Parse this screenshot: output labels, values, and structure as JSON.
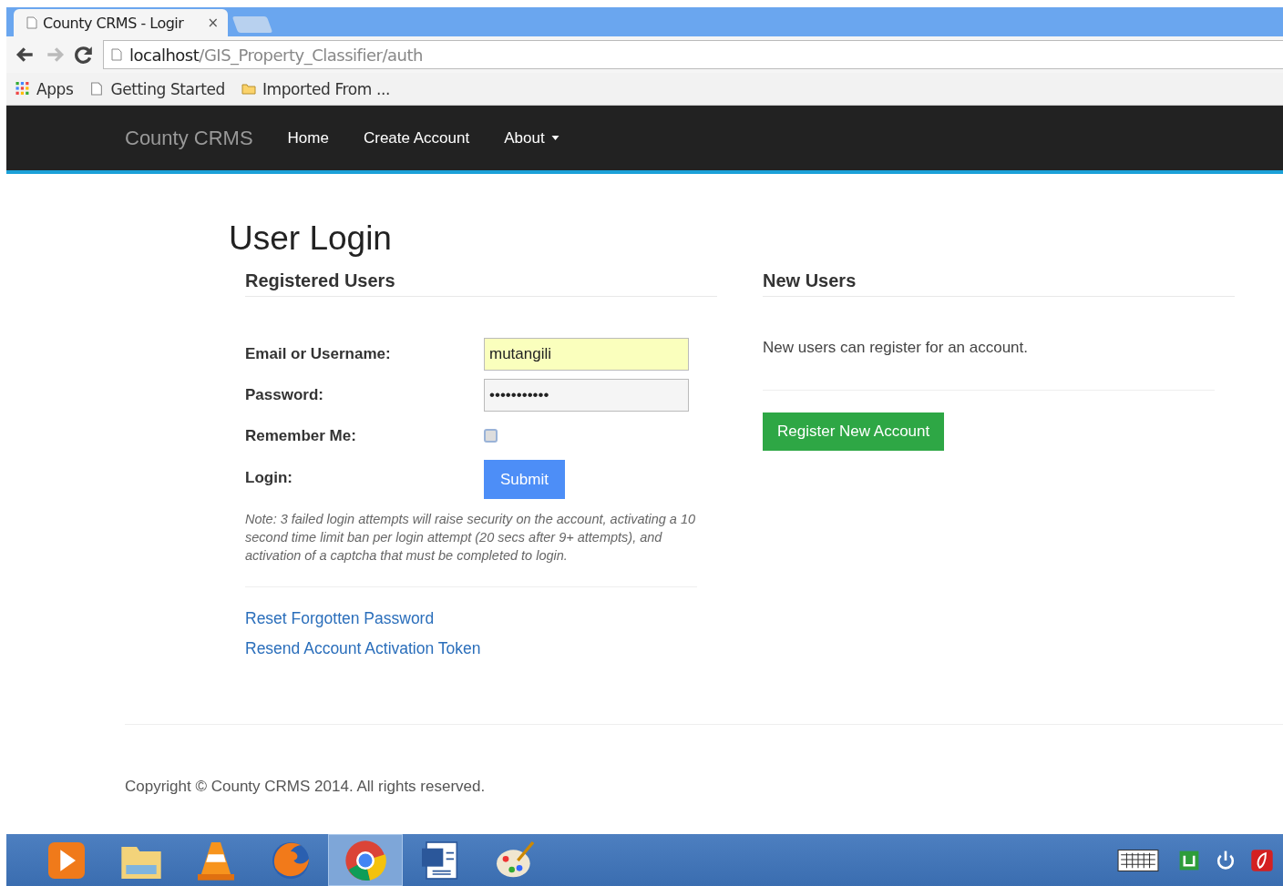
{
  "browser": {
    "tab_title": "County CRMS - Logir",
    "tab_close": "×",
    "address": {
      "host": "localhost",
      "path": "/GIS_Property_Classifier/auth"
    },
    "bookmarks": [
      {
        "kind": "apps",
        "label": "Apps"
      },
      {
        "kind": "page",
        "label": "Getting Started"
      },
      {
        "kind": "folder",
        "label": "Imported From ..."
      }
    ]
  },
  "navbar": {
    "brand": "County CRMS",
    "items": [
      {
        "label": "Home",
        "dropdown": false
      },
      {
        "label": "Create Account",
        "dropdown": false
      },
      {
        "label": "About",
        "dropdown": true
      }
    ]
  },
  "page_title": "User Login",
  "registered": {
    "heading": "Registered Users",
    "fields": [
      {
        "kind": "text",
        "label": "Email or Username:",
        "value": "mutangili",
        "autofilled": true
      },
      {
        "kind": "text",
        "label": "Password:",
        "value": "•••••••••••",
        "autofilled": false
      },
      {
        "kind": "checkbox",
        "label": "Remember Me:",
        "checked": false
      },
      {
        "kind": "button",
        "label": "Login:",
        "button": "Submit"
      }
    ],
    "note": "Note: 3 failed login attempts will raise security on the account, activating a 10 second time limit ban per login attempt (20 secs after 9+ attempts), and activation of a captcha that must be completed to login.",
    "links": [
      "Reset Forgotten Password",
      "Resend Account Activation Token"
    ]
  },
  "new_users": {
    "heading": "New Users",
    "text": "New users can register for an account.",
    "button": "Register New Account"
  },
  "footer": "Copyright © County CRMS 2014. All rights reserved.",
  "taskbar": {
    "apps": [
      {
        "kind": "media",
        "selected": false
      },
      {
        "kind": "explorer",
        "selected": false
      },
      {
        "kind": "cone",
        "selected": false
      },
      {
        "kind": "firefox",
        "selected": false
      },
      {
        "kind": "chrome",
        "selected": true
      },
      {
        "kind": "word",
        "selected": false
      },
      {
        "kind": "paint",
        "selected": false
      }
    ],
    "tray": [
      {
        "kind": "keyboard"
      },
      {
        "kind": "green"
      },
      {
        "kind": "power"
      },
      {
        "kind": "red"
      }
    ]
  }
}
